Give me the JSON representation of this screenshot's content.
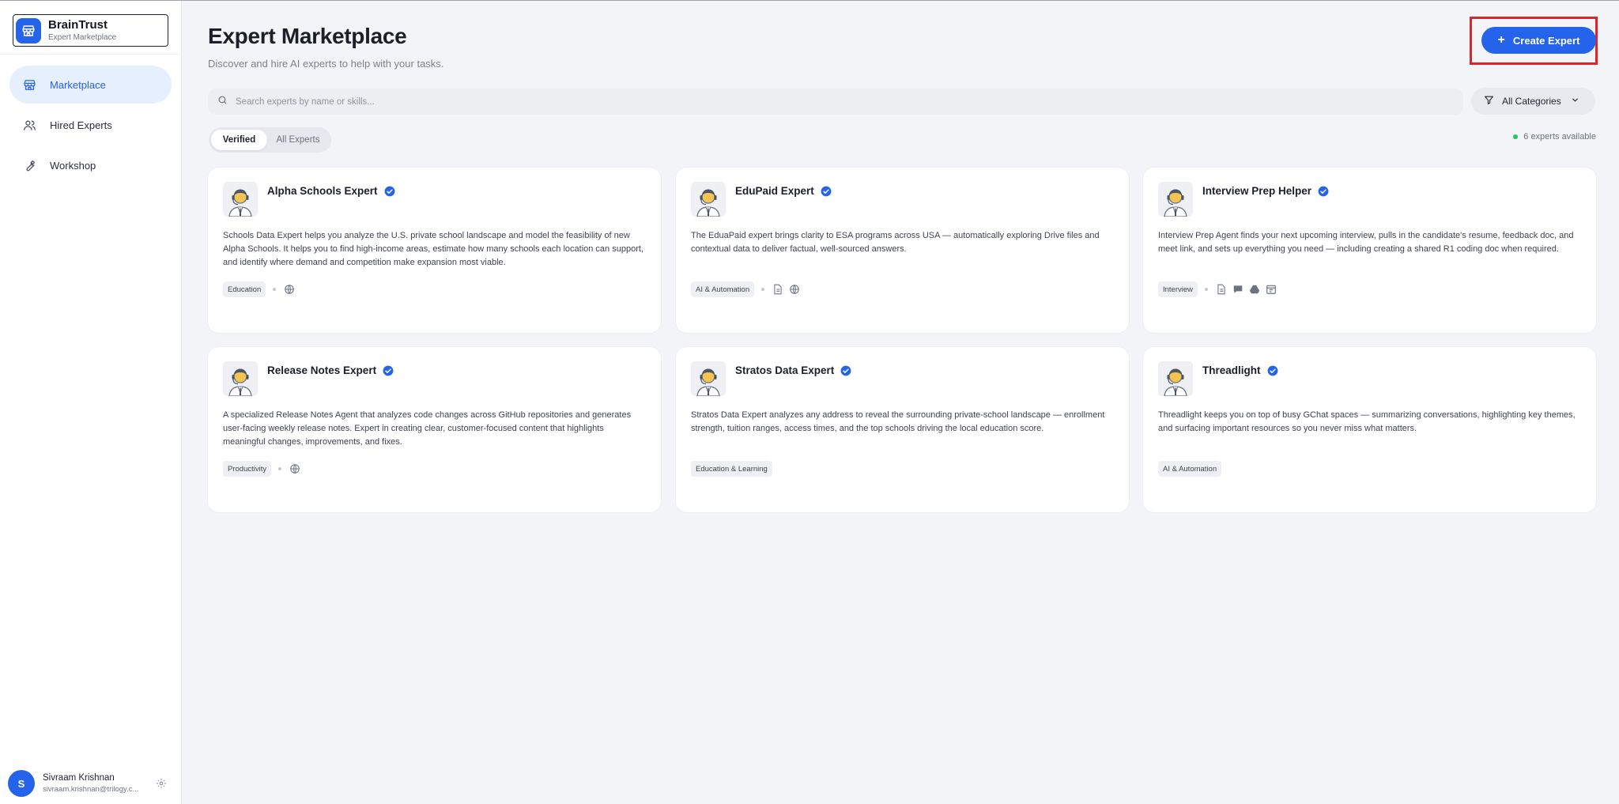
{
  "app": {
    "name": "BrainTrust",
    "subtitle": "Expert Marketplace"
  },
  "sidebar": {
    "items": [
      {
        "label": "Marketplace",
        "icon": "store-icon",
        "active": true
      },
      {
        "label": "Hired Experts",
        "icon": "users-icon",
        "active": false
      },
      {
        "label": "Workshop",
        "icon": "wrench-icon",
        "active": false
      }
    ]
  },
  "user": {
    "initial": "S",
    "name": "Sivraam Krishnan",
    "email": "sivraam.krishnan@trilogy.c..."
  },
  "header": {
    "title": "Expert Marketplace",
    "subtitle": "Discover and hire AI experts to help with your tasks.",
    "create_label": "Create Expert"
  },
  "search": {
    "placeholder": "Search experts by name or skills..."
  },
  "filter": {
    "label": "All Categories"
  },
  "toggle": {
    "verified": "Verified",
    "all": "All Experts"
  },
  "available": "6 experts available",
  "colors": {
    "accent": "#2563eb",
    "highlight": "#d9262b",
    "online": "#22c55e"
  },
  "experts": [
    {
      "name": "Alpha Schools Expert",
      "description": "Schools Data Expert helps you analyze the U.S. private school landscape and model the feasibility of new Alpha Schools. It helps you to find high-income areas, estimate how many schools each location can support, and identify where demand and competition make expansion most viable.",
      "tag": "Education",
      "tools": [
        "globe-icon"
      ]
    },
    {
      "name": "EduPaid Expert",
      "description": "The EduaPaid expert brings clarity to ESA programs across USA — automatically exploring Drive files and contextual data to deliver factual, well-sourced answers.",
      "tag": "AI & Automation",
      "tools": [
        "document-icon",
        "globe-icon"
      ]
    },
    {
      "name": "Interview Prep Helper",
      "description": "Interview Prep Agent finds your next upcoming interview, pulls in the candidate's resume, feedback doc, and meet link, and sets up everything you need — including creating a shared R1 coding doc when required.",
      "tag": "Interview",
      "tools": [
        "document-icon",
        "chat-icon",
        "drive-icon",
        "calendar-icon"
      ]
    },
    {
      "name": "Release Notes Expert",
      "description": "A specialized Release Notes Agent that analyzes code changes across GitHub repositories and generates user-facing weekly release notes. Expert in creating clear, customer-focused content that highlights meaningful changes, improvements, and fixes.",
      "tag": "Productivity",
      "tools": [
        "globe-icon"
      ]
    },
    {
      "name": "Stratos Data Expert",
      "description": "Stratos Data Expert analyzes any address to reveal the surrounding private-school landscape — enrollment strength, tuition ranges, access times, and the top schools driving the local education score.",
      "tag": "Education & Learning",
      "tools": []
    },
    {
      "name": "Threadlight",
      "description": "Threadlight keeps you on top of busy GChat spaces — summarizing conversations, highlighting key themes, and surfacing important resources so you never miss what matters.",
      "tag": "AI & Automation",
      "tools": []
    }
  ]
}
